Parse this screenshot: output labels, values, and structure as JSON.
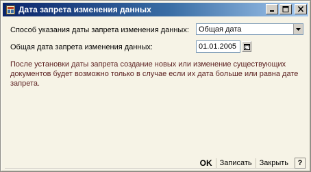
{
  "window": {
    "title": "Дата запрета изменения данных",
    "controls": [
      "minimize-icon",
      "maximize-icon",
      "close-icon"
    ]
  },
  "form": {
    "method_label": "Способ указания даты запрета изменения данных:",
    "method_value": "Общая дата",
    "date_label": "Общая дата запрета изменения данных:",
    "date_value": "01.01.2005"
  },
  "info_text": "После установки даты запрета создание новых или изменение существующих документов будет возможно только в случае если их дата больше или равна дате запрета.",
  "buttons": {
    "ok": "OK",
    "save": "Записать",
    "close": "Закрыть",
    "help": "?"
  },
  "colors": {
    "title_gradient_start": "#0a246a",
    "title_gradient_end": "#a6caf0",
    "dialog_bg": "#f6f3e6",
    "info_text": "#5a1e1e"
  }
}
